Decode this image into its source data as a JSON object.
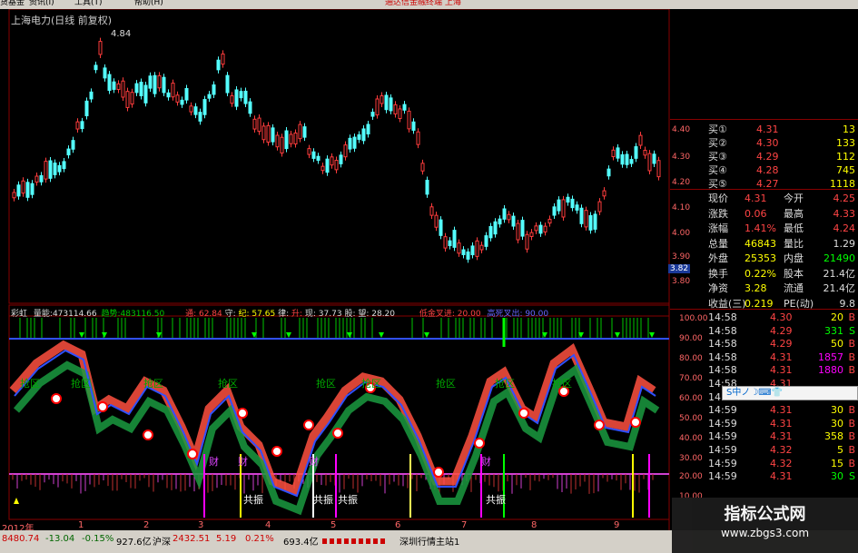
{
  "menu": [
    "货基金",
    "资讯(I)",
    "工具(T)",
    "帮助(H)"
  ],
  "promo": "通达信金融终端  上海",
  "stock_title": "上海电力(日线 前复权)",
  "peak_label": "4.84",
  "price_axis": [
    "4.40",
    "4.30",
    "4.20",
    "4.10",
    "4.00",
    "3.90",
    "3.82",
    "3.80"
  ],
  "indicator_line": {
    "name": "彩虹",
    "vol_label": "量能:",
    "vol_value": "473114.66",
    "trend_label": "趋势:",
    "trend_value": "483116.50",
    "tong": "通: 62.84",
    "shou": "守: ",
    "ji": "纪: 57.65",
    "lv": "律: ",
    "sheng": "升: ",
    "xian": "现: 37.73",
    "gu": "股: ",
    "wang": "望: 28.20",
    "dijin": "低金叉进: 20.00",
    "gaosi": "高死叉出: 90.00"
  },
  "osc_axis": [
    "100.00",
    "90.00",
    "80.00",
    "70.00",
    "60.00",
    "50.00",
    "40.00",
    "30.00",
    "20.00",
    "10.00"
  ],
  "osc_labels": [
    "抢区",
    "抢区",
    "抢区",
    "抢区",
    "抢区",
    "抢区",
    "抢区",
    "抢区",
    "抢区",
    "共振",
    "共振",
    "共振",
    "共振",
    "财",
    "财",
    "财",
    "财"
  ],
  "date_axis": {
    "year": "2012年",
    "months": [
      "1",
      "2",
      "3",
      "4",
      "5",
      "6",
      "7",
      "8",
      "9"
    ]
  },
  "quotes": [
    {
      "label": "买①",
      "price": "4.31",
      "vol": "13"
    },
    {
      "label": "买②",
      "price": "4.30",
      "vol": "133"
    },
    {
      "label": "买③",
      "price": "4.29",
      "vol": "112"
    },
    {
      "label": "买④",
      "price": "4.28",
      "vol": "745"
    },
    {
      "label": "买⑤",
      "price": "4.27",
      "vol": "1118"
    }
  ],
  "stats": [
    {
      "l1": "现价",
      "v1": "4.31",
      "l2": "今开",
      "v2": "4.25"
    },
    {
      "l1": "涨跌",
      "v1": "0.06",
      "l2": "最高",
      "v2": "4.33"
    },
    {
      "l1": "涨幅",
      "v1": "1.41%",
      "l2": "最低",
      "v2": "4.24"
    },
    {
      "l1": "总量",
      "v1": "46843",
      "l2": "量比",
      "v2": "1.29"
    },
    {
      "l1": "外盘",
      "v1": "25353",
      "l2": "内盘",
      "v2": "21490"
    },
    {
      "l1": "换手",
      "v1": "0.22%",
      "l2": "股本",
      "v2": "21.4亿"
    },
    {
      "l1": "净资",
      "v1": "3.28",
      "l2": "流通",
      "v2": "21.4亿"
    },
    {
      "l1": "收益(三)",
      "v1": "0.219",
      "l2": "PE(动)",
      "v2": "9.8"
    }
  ],
  "ticks": [
    {
      "time": "14:58",
      "price": "4.30",
      "vol": "20",
      "bs": "B"
    },
    {
      "time": "14:58",
      "price": "4.29",
      "vol": "331",
      "bs": "S"
    },
    {
      "time": "14:58",
      "price": "4.29",
      "vol": "50",
      "bs": "B"
    },
    {
      "time": "14:58",
      "price": "4.31",
      "vol": "1857",
      "bs": "B"
    },
    {
      "time": "14:58",
      "price": "4.31",
      "vol": "1880",
      "bs": "B"
    },
    {
      "time": "14:58",
      "price": "4.31",
      "vol": "",
      "bs": ""
    },
    {
      "time": "14:58",
      "price": "4.31",
      "vol": "",
      "bs": ""
    },
    {
      "time": "14:59",
      "price": "4.31",
      "vol": "30",
      "bs": "B"
    },
    {
      "time": "14:59",
      "price": "4.31",
      "vol": "30",
      "bs": "B"
    },
    {
      "time": "14:59",
      "price": "4.31",
      "vol": "358",
      "bs": "B"
    },
    {
      "time": "14:59",
      "price": "4.32",
      "vol": "5",
      "bs": "B"
    },
    {
      "time": "14:59",
      "price": "4.32",
      "vol": "15",
      "bs": "B"
    },
    {
      "time": "14:59",
      "price": "4.31",
      "vol": "30",
      "bs": "S"
    }
  ],
  "ime": "S中ノ☽⌨👕",
  "status": {
    "sh_index": "8480.74",
    "sh_change": "-13.04",
    "sh_pct": "-0.15%",
    "sh_amount": "927.6亿",
    "hs_label": "沪深",
    "hs_index": "2432.51",
    "hs_change": "5.19",
    "hs_pct": "0.21%",
    "hs_amount": "693.4亿",
    "station": "深圳行情主站1"
  },
  "watermark": {
    "title": "指标公式网",
    "url": "www.zbgs3.com"
  },
  "colors": {
    "up": "#ff3c3c",
    "down": "#54ffff",
    "green": "#00c800",
    "purple": "#d040d0",
    "yellow": "#ffff00",
    "blue": "#3050ff"
  }
}
